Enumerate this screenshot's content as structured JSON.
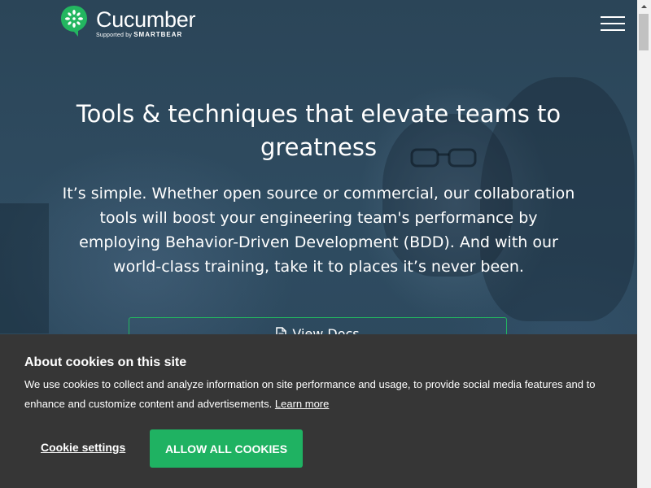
{
  "brand": {
    "name": "Cucumber",
    "supported_by": "Supported by",
    "partner": "SMARTBEAR",
    "accent_color": "#23b660"
  },
  "nav": {
    "menu_icon": "hamburger-menu-icon"
  },
  "hero": {
    "headline": "Tools & techniques that elevate teams to greatness",
    "lead": "It’s simple. Whether open source or commercial, our collaboration tools will boost your engineering team's performance by employing Behavior-Driven Development (BDD). And with our world-class training, take it to places it’s never been.",
    "docs_button": "View Docs",
    "docs_icon": "document-icon"
  },
  "cookie_banner": {
    "title": "About cookies on this site",
    "text": "We use cookies to collect and analyze information on site performance and usage, to provide social media features and to enhance and customize content and advertisements.",
    "learn_more": "Learn more",
    "settings": "Cookie settings",
    "allow_all": "ALLOW ALL COOKIES",
    "background_color": "#363636",
    "button_color": "#1fb262"
  }
}
